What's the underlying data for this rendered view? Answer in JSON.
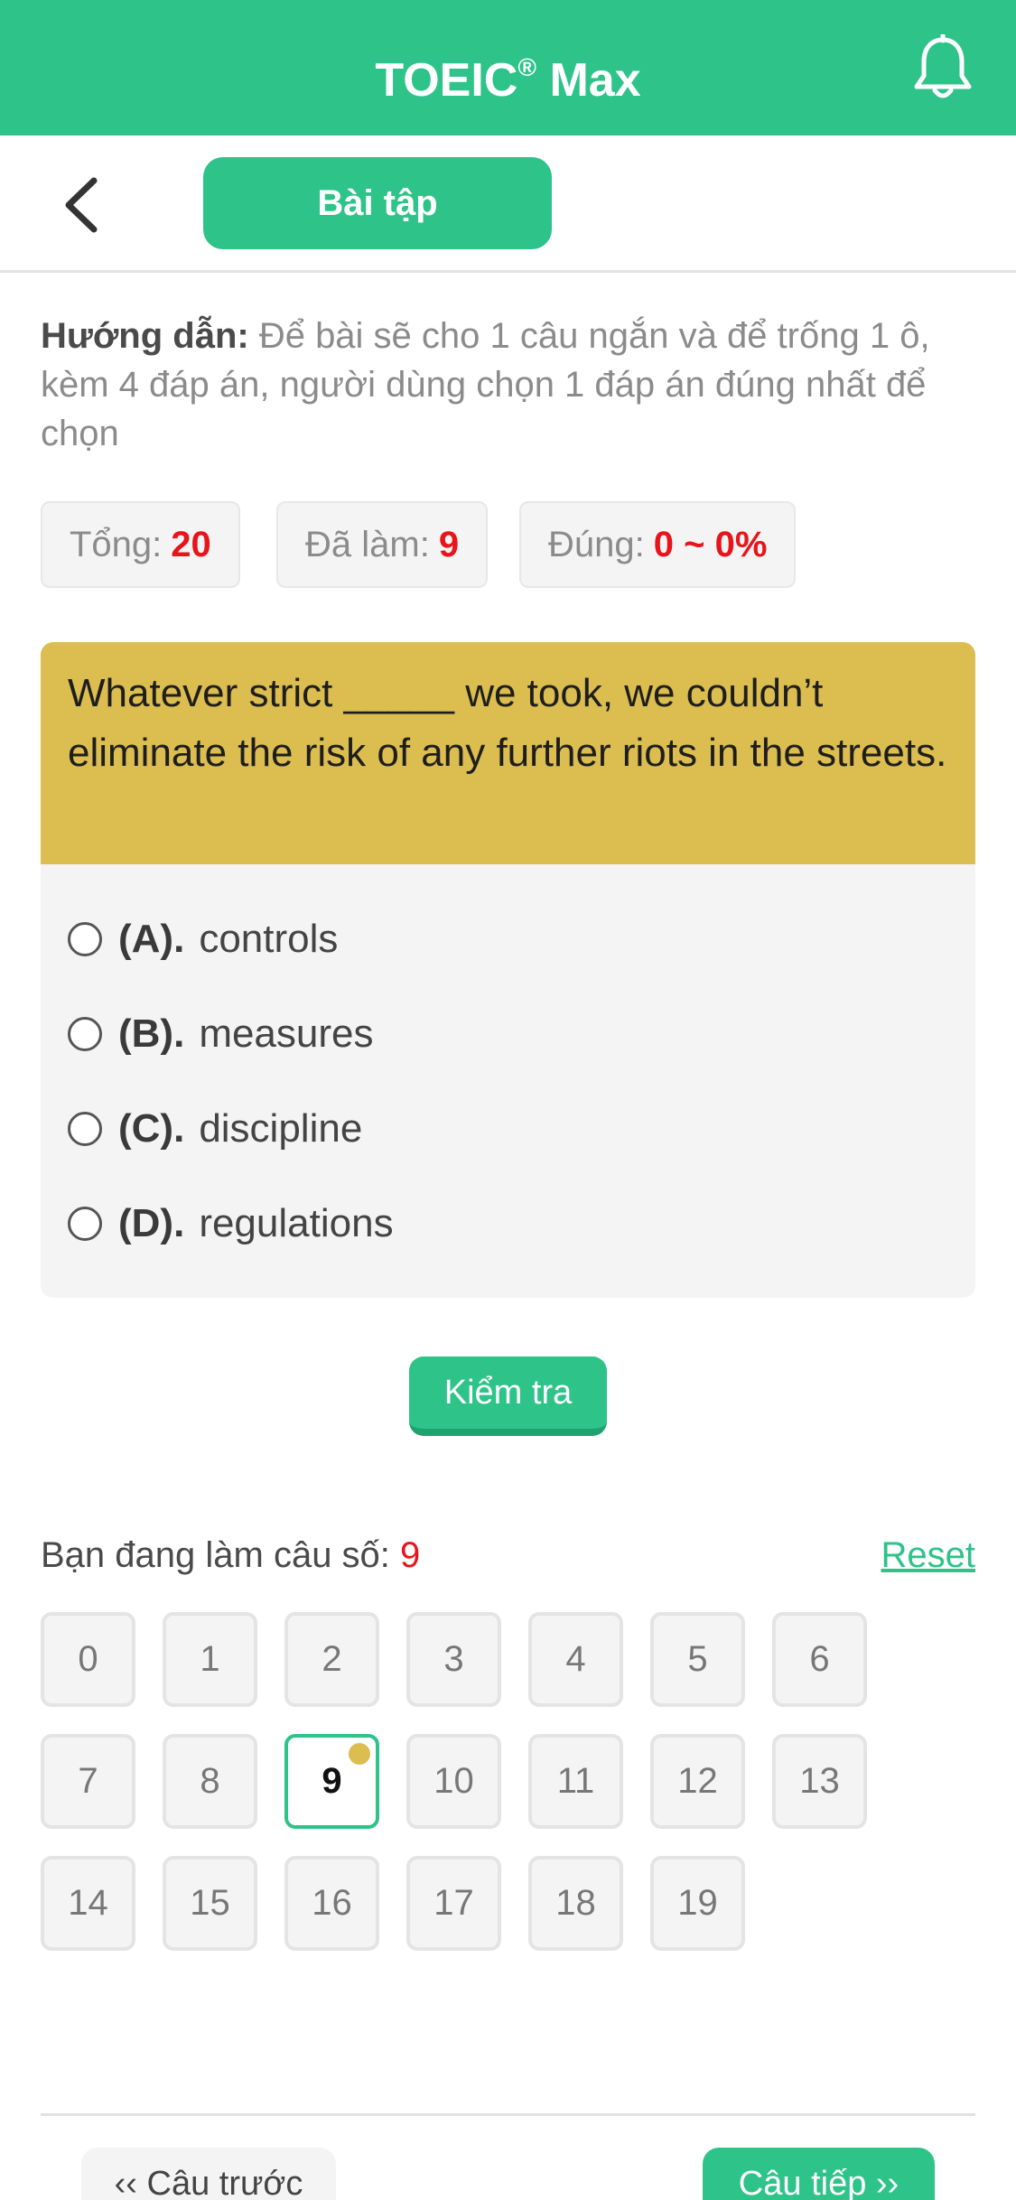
{
  "header": {
    "title": "TOEIC",
    "title_mark": "®",
    "title_suffix": " Max",
    "bell_icon": "bell-icon",
    "color": "#2dc389"
  },
  "subbar": {
    "back_icon": "chevron-left-icon",
    "tab_label": "Bài tập"
  },
  "guide": {
    "label": "Hướng dẫn:",
    "text": " Để bài sẽ cho 1 câu ngắn và để trống 1 ô, kèm 4 đáp án, người dùng chọn 1 đáp án đúng nhất để chọn"
  },
  "stats": {
    "total_label": "Tổng:",
    "total_value": "20",
    "done_label": "Đã làm:",
    "done_value": "9",
    "correct_label": "Đúng:",
    "correct_value": "0 ~ 0%"
  },
  "question": {
    "text": "Whatever strict _____ we took, we couldn’t eliminate the risk of any further riots in the streets.",
    "options": [
      {
        "letter": "(A).",
        "text": "controls"
      },
      {
        "letter": "(B).",
        "text": "measures"
      },
      {
        "letter": "(C).",
        "text": "discipline"
      },
      {
        "letter": "(D).",
        "text": "regulations"
      }
    ]
  },
  "check_button": "Kiểm tra",
  "progress": {
    "label": "Bạn đang làm câu số:",
    "current": "9",
    "reset": "Reset",
    "numbers": [
      "0",
      "1",
      "2",
      "3",
      "4",
      "5",
      "6",
      "7",
      "8",
      "9",
      "10",
      "11",
      "12",
      "13",
      "14",
      "15",
      "16",
      "17",
      "18",
      "19"
    ]
  },
  "nav": {
    "prev": "‹‹ Câu trước",
    "next": "Câu tiếp ››"
  },
  "colors": {
    "accent": "#2dc389",
    "question_bg": "#dcbd4f",
    "highlight": "#e8141b"
  }
}
